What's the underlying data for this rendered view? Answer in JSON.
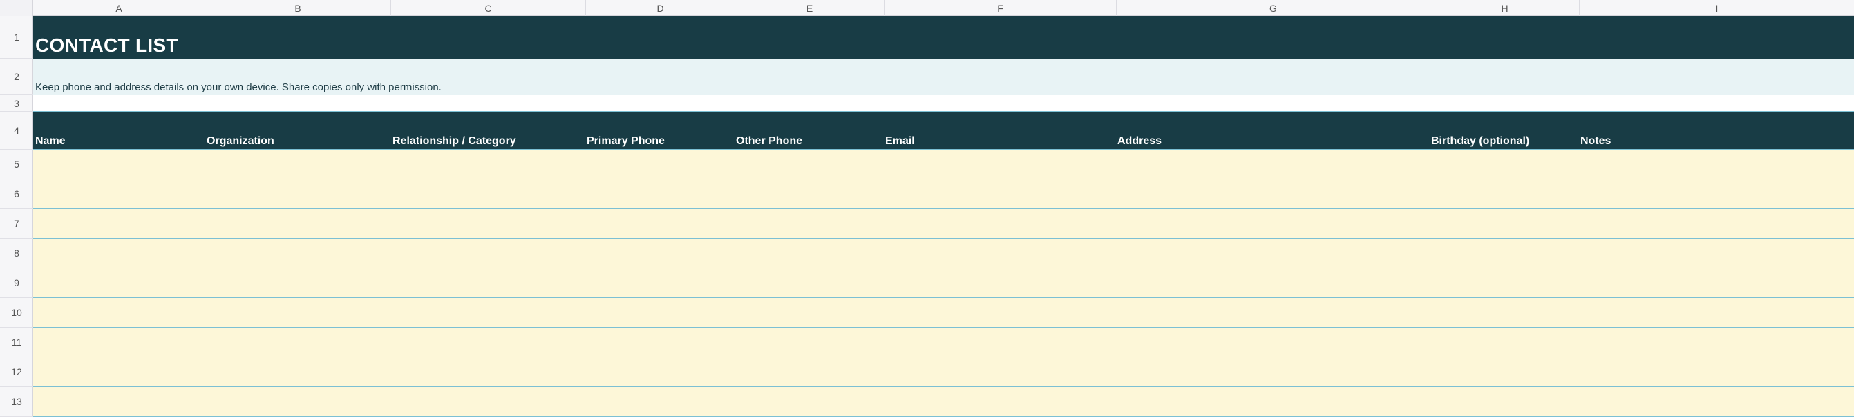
{
  "columns": [
    "A",
    "B",
    "C",
    "D",
    "E",
    "F",
    "G",
    "H",
    "I"
  ],
  "rows": [
    "1",
    "2",
    "3",
    "4",
    "5",
    "6",
    "7",
    "8",
    "9",
    "10",
    "11",
    "12",
    "13"
  ],
  "title": "CONTACT LIST",
  "note": "Keep phone and address details on your own device. Share copies only with permission.",
  "headers": [
    "Name",
    "Organization",
    "Relationship / Category",
    "Primary Phone",
    "Other Phone",
    "Email",
    "Address",
    "Birthday (optional)",
    "Notes"
  ],
  "colors": {
    "header_bg": "#183c45",
    "note_bg": "#e8f3f5",
    "data_bg": "#fdf7d8",
    "border": "#7cc0d4"
  }
}
